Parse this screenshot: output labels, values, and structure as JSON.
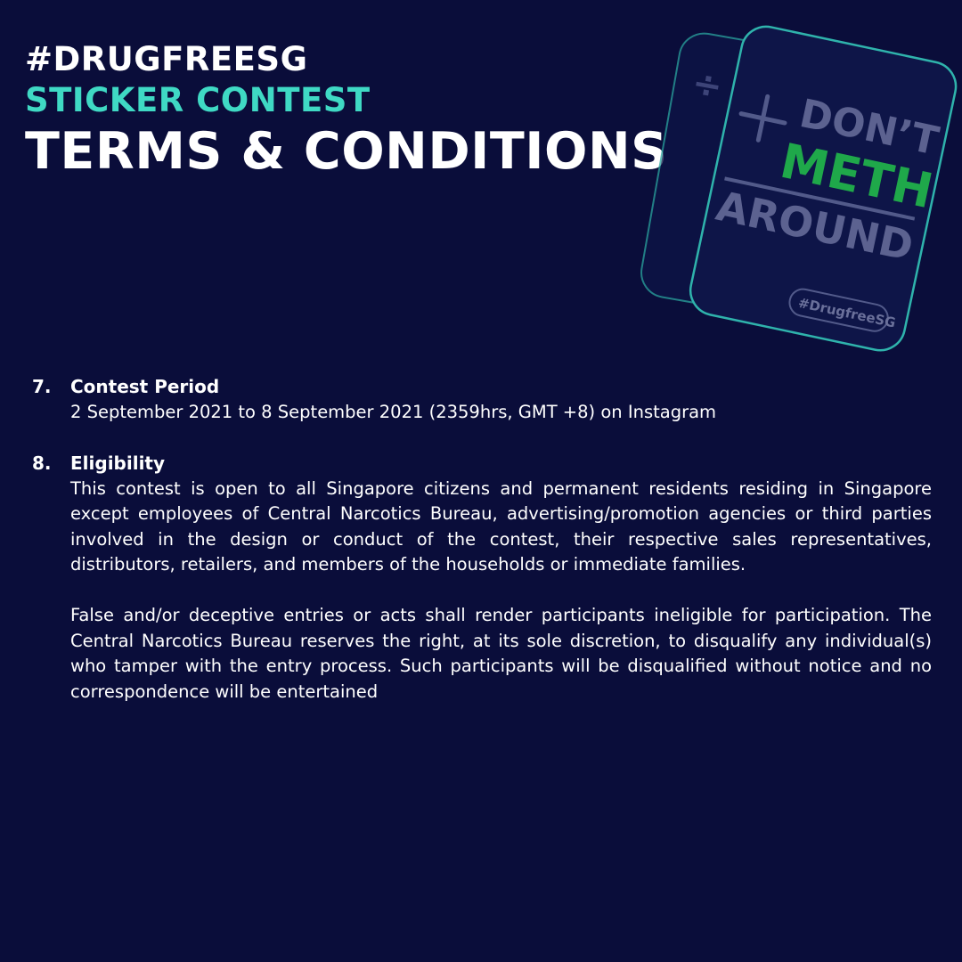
{
  "header": {
    "hashtag": "#DRUGFREESG",
    "subtitle": "STICKER CONTEST",
    "title": "TERMS & CONDITIONS"
  },
  "sticker": {
    "line1": "DON’T",
    "line2": "METH",
    "line3": "AROUND",
    "tag": "#DrugfreeSG"
  },
  "terms": [
    {
      "number": "7.",
      "heading": "Contest Period",
      "paragraphs": [
        "2 September 2021 to 8 September 2021 (2359hrs, GMT +8) on Instagram"
      ]
    },
    {
      "number": "8.",
      "heading": "Eligibility",
      "paragraphs": [
        "This contest is open to all Singapore citizens and permanent residents residing in Singapore except employees of Central Narcotics Bureau, advertising/promotion agencies or third parties involved in the design or conduct of the contest, their respective sales representatives, distributors, retailers, and members of the households or immediate families.",
        "False and/or deceptive entries or acts shall render participants ineligible for participation. The Central Narcotics Bureau reserves the right, at its sole discretion, to disqualify any individual(s) who tamper with the entry process. Such participants will be disqualified without notice and no correspondence will be entertained"
      ]
    }
  ],
  "colors": {
    "background": "#0a0d3a",
    "accent": "#3fd9c4",
    "sticker_green": "#1fa84a",
    "sticker_grey": "#8a8fb0"
  }
}
